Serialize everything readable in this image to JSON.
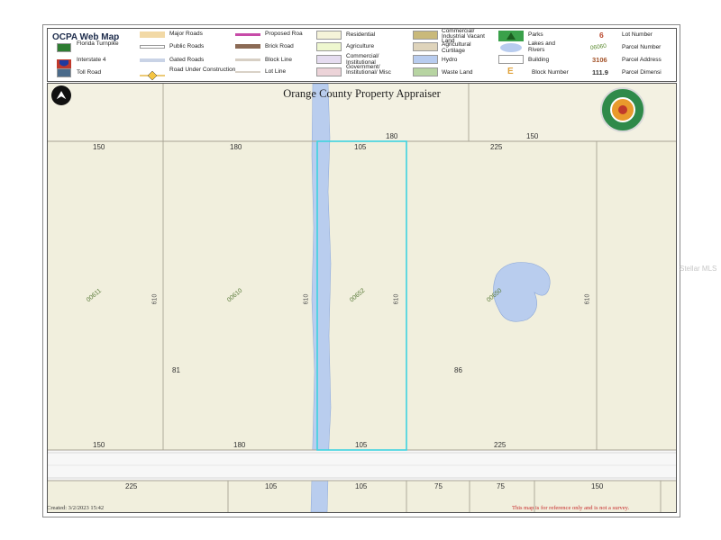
{
  "legend": {
    "title": "OCPA Web Map",
    "items": [
      {
        "label": "Major Roads",
        "color": "#f2d9a6"
      },
      {
        "label": "Proposed Roa",
        "color": "#c74ba8"
      },
      {
        "label": "Residential",
        "color": "#f5f3d9"
      },
      {
        "label": "Commercial/ Industrial Vacant Land",
        "color": "#c9b97a"
      },
      {
        "label": "Parks",
        "color": "#3aa14a"
      },
      {
        "label": "Lot Number",
        "number": "6",
        "color": "#b9462b"
      },
      {
        "label": "Florida Turnpike",
        "color": "#2e7d32"
      },
      {
        "label": "Public Roads",
        "color": "#ffffff"
      },
      {
        "label": "Brick Road",
        "color": "#8b6a55"
      },
      {
        "label": "Agriculture",
        "color": "#eef7cf"
      },
      {
        "label": "Agricultural Curtilage",
        "color": "#dfd4bb"
      },
      {
        "label": "Lakes and Rivers",
        "color": "#b8ccef"
      },
      {
        "label": "Parcel Number",
        "number": "06060",
        "color": "#5a8a2f"
      },
      {
        "label": "Interstate 4",
        "color": "#3b47a8"
      },
      {
        "label": "Gated Roads",
        "color": "#c9d3e6"
      },
      {
        "label": "Block Line",
        "color": "#d7cfc4"
      },
      {
        "label": "Commercial/ Institutional",
        "color": "#e5dcf0"
      },
      {
        "label": "Hydro",
        "color": "#b8ccef"
      },
      {
        "label": "Building",
        "color": "#ffffff"
      },
      {
        "label": "Parcel Address",
        "number": "3106",
        "color": "#a4542b"
      },
      {
        "label": "Toll Road",
        "color": "#4a6a8a"
      },
      {
        "label": "Road Under Construction",
        "color": "#e6b84a"
      },
      {
        "label": "Lot Line",
        "color": "#d9d2c7"
      },
      {
        "label": "Government/ Institutional/ Misc",
        "color": "#ecd3d8"
      },
      {
        "label": "Waste Land",
        "color": "#b7d4a2"
      },
      {
        "label": "Block Number",
        "number": "E",
        "color": "#e0a23a"
      },
      {
        "label": "Parcel Dimensi",
        "number": "111.9",
        "color": "#333333"
      }
    ]
  },
  "map": {
    "title": "Orange County Property Appraiser",
    "dimensions": {
      "top_row": [
        "180",
        "150"
      ],
      "upper_row": [
        "150",
        "180",
        "105",
        "225"
      ],
      "side_widths": [
        "81",
        "86"
      ],
      "lower_row": [
        "150",
        "180",
        "105",
        "225"
      ],
      "bottom_row": [
        "225",
        "105",
        "105",
        "75",
        "75",
        "150"
      ]
    },
    "parcels": [
      "00611",
      "00610",
      "00652",
      "00650"
    ],
    "side_marks": [
      "610",
      "610",
      "610",
      "610"
    ]
  },
  "footer": {
    "created": "Created: 3/2/2023 15:42",
    "disclaimer": "This map is for reference only and is not a survey."
  },
  "watermark": "Stellar MLS"
}
